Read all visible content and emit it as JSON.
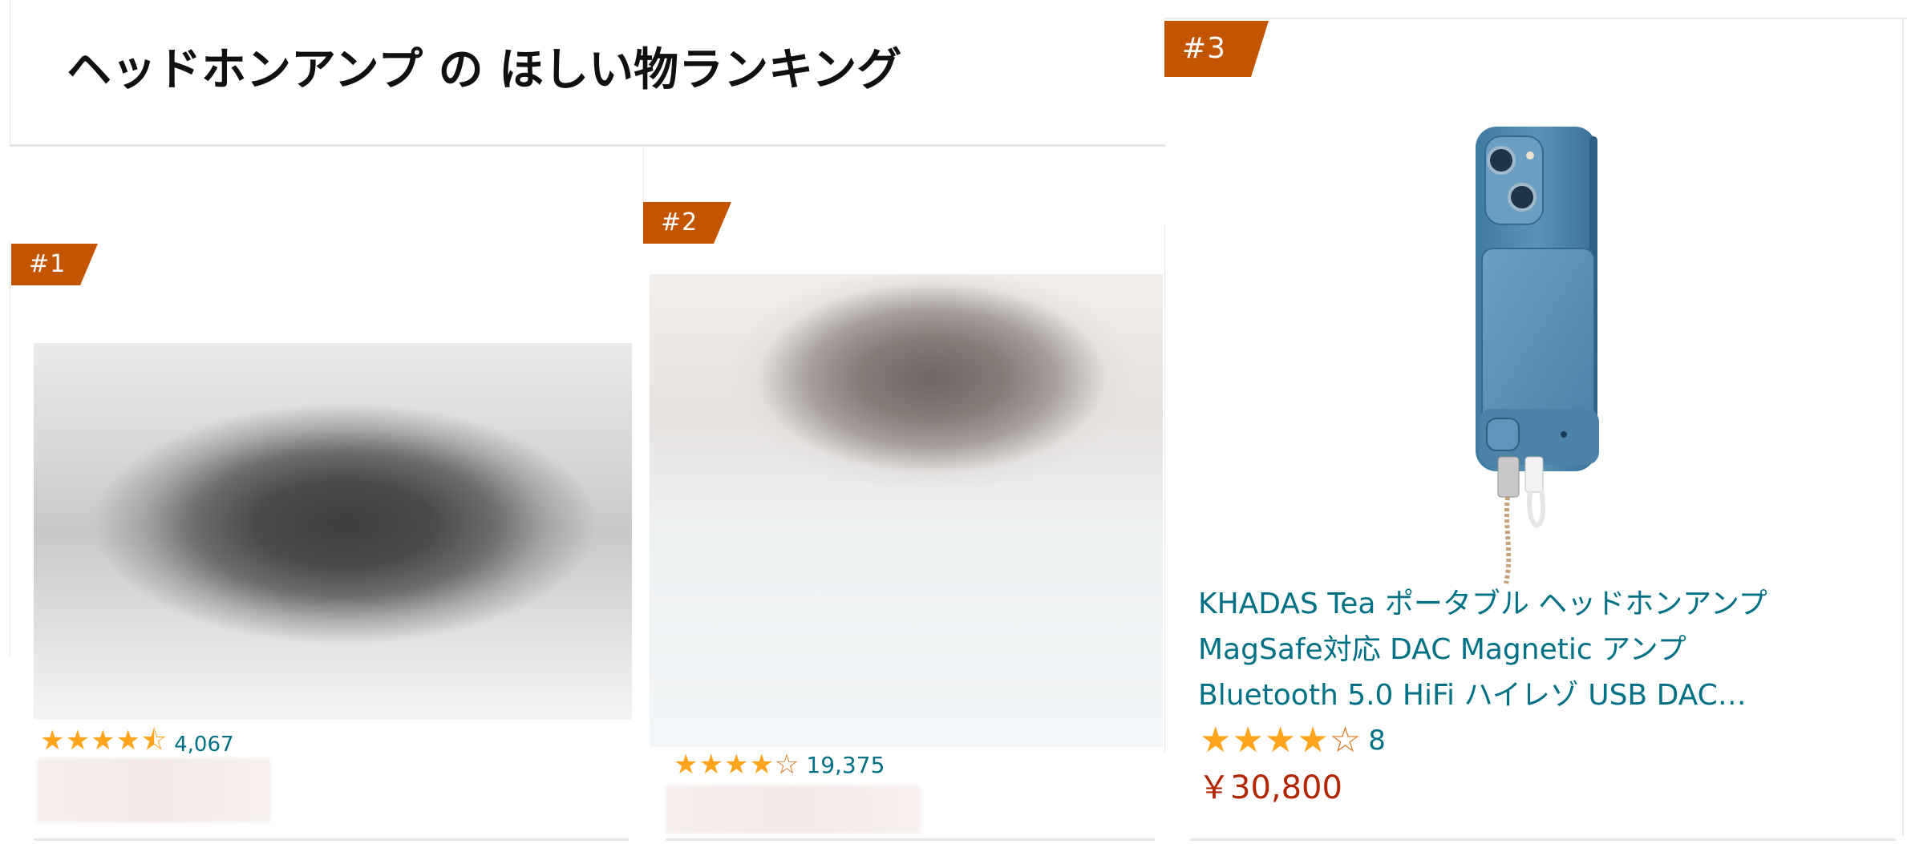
{
  "page": {
    "title": "ヘッドホンアンプ の ほしい物ランキング"
  },
  "products": [
    {
      "rank": "#1",
      "rating": 4.5,
      "stars": "★★★★",
      "stars_partial": "⯪",
      "stars_empty": "",
      "review_count": "4,067"
    },
    {
      "rank": "#2",
      "rating": 4.0,
      "stars": "★★★★",
      "stars_partial": "",
      "stars_empty": "☆",
      "review_count": "19,375"
    },
    {
      "rank": "#3",
      "rating": 4.0,
      "stars": "★★★★",
      "stars_partial": "",
      "stars_empty": "☆",
      "review_count": "8",
      "title_lines": [
        "KHADAS Tea ポータブル ヘッドホンアンプ",
        "MagSafe対応 DAC Magnetic アンプ",
        "Bluetooth 5.0 HiFi ハイレゾ USB DAC…"
      ],
      "price": "￥30,800"
    }
  ],
  "colors": {
    "badge": "#c45500",
    "link": "#007185",
    "star": "#ffa41c",
    "price": "#b12704",
    "phone_body": "#4f86ab"
  }
}
